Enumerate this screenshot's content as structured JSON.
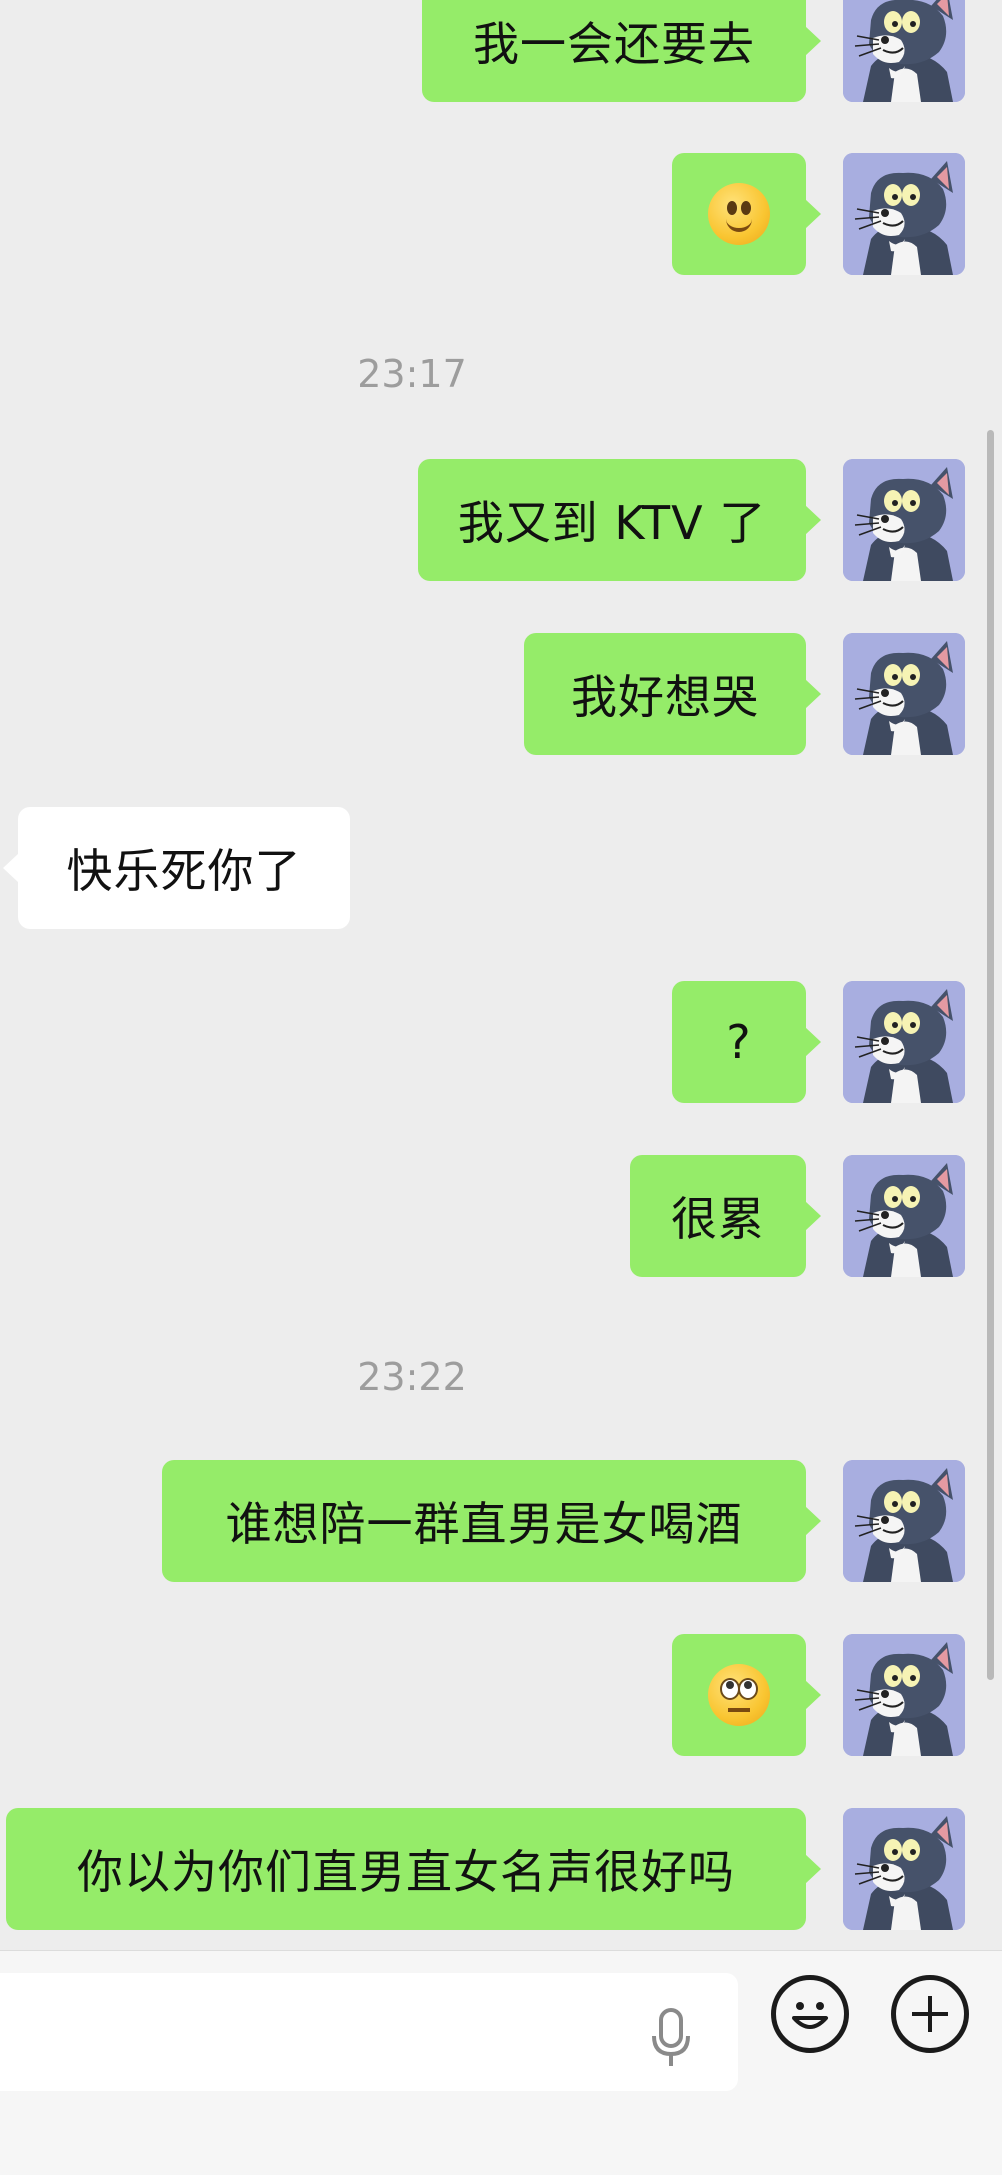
{
  "conversation": {
    "messages": [
      {
        "sender": "me",
        "type": "text",
        "text": "我一会还要去"
      },
      {
        "sender": "me",
        "type": "emoji",
        "emoji": "smile-emoji"
      },
      {
        "type": "time",
        "text": "23:17"
      },
      {
        "sender": "me",
        "type": "text",
        "text": "我又到 KTV 了"
      },
      {
        "sender": "me",
        "type": "text",
        "text": "我好想哭"
      },
      {
        "sender": "other",
        "type": "text",
        "text": "快乐死你了"
      },
      {
        "sender": "me",
        "type": "text",
        "text": "?"
      },
      {
        "sender": "me",
        "type": "text",
        "text": "很累"
      },
      {
        "type": "time",
        "text": "23:22"
      },
      {
        "sender": "me",
        "type": "text",
        "text": "谁想陪一群直男是女喝酒"
      },
      {
        "sender": "me",
        "type": "emoji",
        "emoji": "eye-roll-emoji"
      },
      {
        "sender": "me",
        "type": "text",
        "text": "你以为你们直男直女名声很好吗"
      }
    ]
  },
  "avatar": {
    "description_icon": "cartoon-cat-avatar",
    "bg": "#a8aee0"
  },
  "colors": {
    "sent_bubble": "#95ec69",
    "received_bubble": "#ffffff",
    "background": "#ededed",
    "timestamp": "#9d9d9d"
  },
  "input_bar": {
    "text_value": "",
    "icons": [
      "microphone-icon",
      "emoji-face-icon",
      "plus-icon"
    ]
  }
}
